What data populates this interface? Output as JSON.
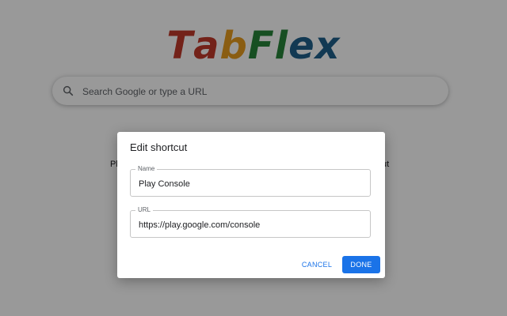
{
  "logo": {
    "letters": [
      "T",
      "a",
      "b",
      "F",
      "l",
      "e",
      "x"
    ],
    "colors": [
      "#c0392b",
      "#c0392b",
      "#e69b1f",
      "#27843a",
      "#27843a",
      "#1f5f8b",
      "#1f5f8b"
    ]
  },
  "search": {
    "placeholder": "Search Google or type a URL",
    "icon": "search-icon"
  },
  "shortcuts": {
    "left_label": "Pl",
    "right_label": "ut"
  },
  "dialog": {
    "title": "Edit shortcut",
    "name_label": "Name",
    "name_value": "Play Console",
    "url_label": "URL",
    "url_value": "https://play.google.com/console",
    "cancel_label": "CANCEL",
    "done_label": "DONE",
    "accent_color": "#1a73e8"
  }
}
